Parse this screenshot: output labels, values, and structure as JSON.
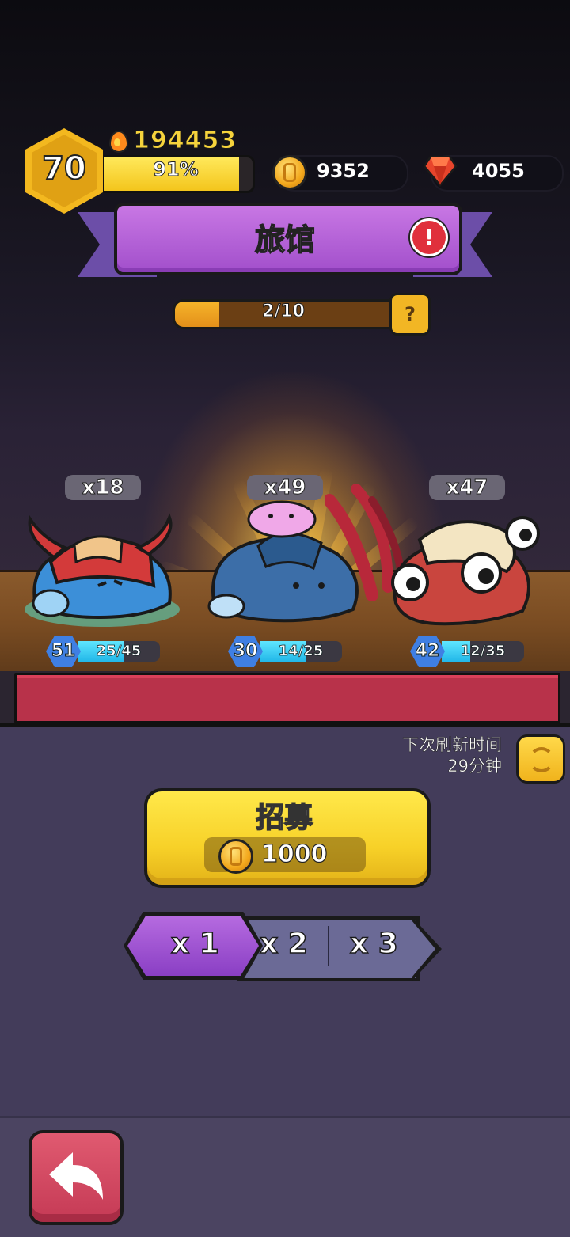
{
  "player": {
    "level": "70",
    "power": "194453",
    "xp_percent_label": "91%",
    "xp_fraction": 0.91
  },
  "resources": {
    "coins": "9352",
    "gems": "4055"
  },
  "banner": {
    "title": "旅馆",
    "alert": "!"
  },
  "progress": {
    "label": "2/10",
    "fraction": 0.2,
    "help": "?"
  },
  "heroes": [
    {
      "count": "x18",
      "level": "51",
      "hp_label": "25/45",
      "hp_fraction": 0.556
    },
    {
      "count": "x49",
      "level": "30",
      "hp_label": "14/25",
      "hp_fraction": 0.56
    },
    {
      "count": "x47",
      "level": "42",
      "hp_label": "12/35",
      "hp_fraction": 0.343
    }
  ],
  "refresh": {
    "line1": "下次刷新时间",
    "line2": "29分钟"
  },
  "recruit": {
    "title": "招募",
    "cost": "1000"
  },
  "multipliers": [
    {
      "label": "x 1",
      "active": true
    },
    {
      "label": "x 2",
      "active": false
    },
    {
      "label": "x 3",
      "active": false
    }
  ],
  "colors": {
    "accent_purple": "#a24fcb",
    "gold": "#f7d128",
    "back_red": "#c53a55",
    "hp_cyan": "#22b7e8"
  },
  "icons": {
    "back": "back-arrow-icon",
    "refresh": "refresh-icon",
    "coin": "coin-icon",
    "gem": "gem-icon",
    "flame": "flame-icon"
  }
}
